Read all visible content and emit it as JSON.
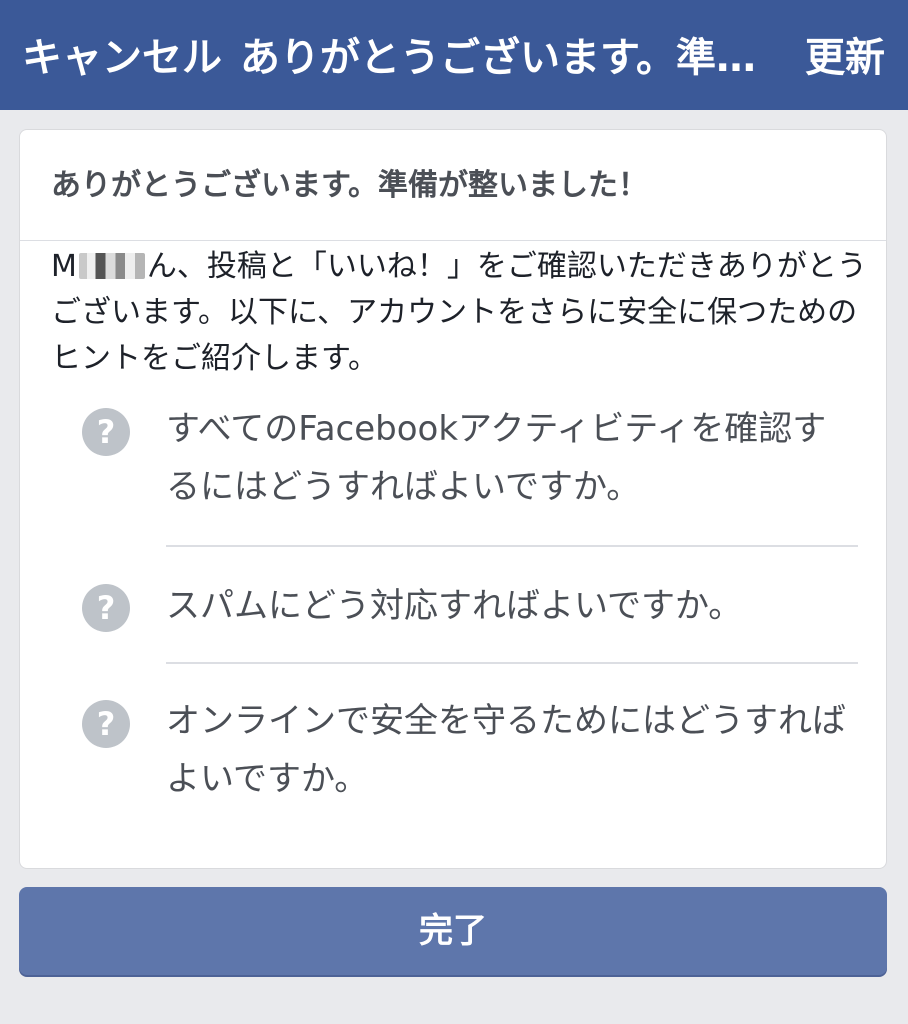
{
  "nav": {
    "cancel_label": "キャンセル",
    "title": "ありがとうございます。準備が整いました！",
    "refresh_label": "更新"
  },
  "card": {
    "header_title": "ありがとうございます。準備が整いました！",
    "intro_name_prefix": "M",
    "intro_name_suffix": "ん",
    "intro_text": "、投稿と「いいね！」をご確認いただきありがとうございます。以下に、アカウントをさらに安全に保つためのヒントをご紹介します。",
    "help_items": [
      {
        "icon": "question-icon",
        "glyph": "?",
        "label": "すべてのFacebookアクティビティを確認するにはどうすればよいですか。"
      },
      {
        "icon": "question-icon",
        "glyph": "?",
        "label": "スパムにどう対応すればよいですか。"
      },
      {
        "icon": "question-icon",
        "glyph": "?",
        "label": "オンラインで安全を守るためにはどうすればよいですか。"
      }
    ]
  },
  "footer": {
    "done_label": "完了"
  },
  "colors": {
    "nav_bg": "#3b5998",
    "button_bg": "#5e76ab",
    "page_bg": "#e9eaed",
    "icon_bg": "#bec3c9"
  }
}
